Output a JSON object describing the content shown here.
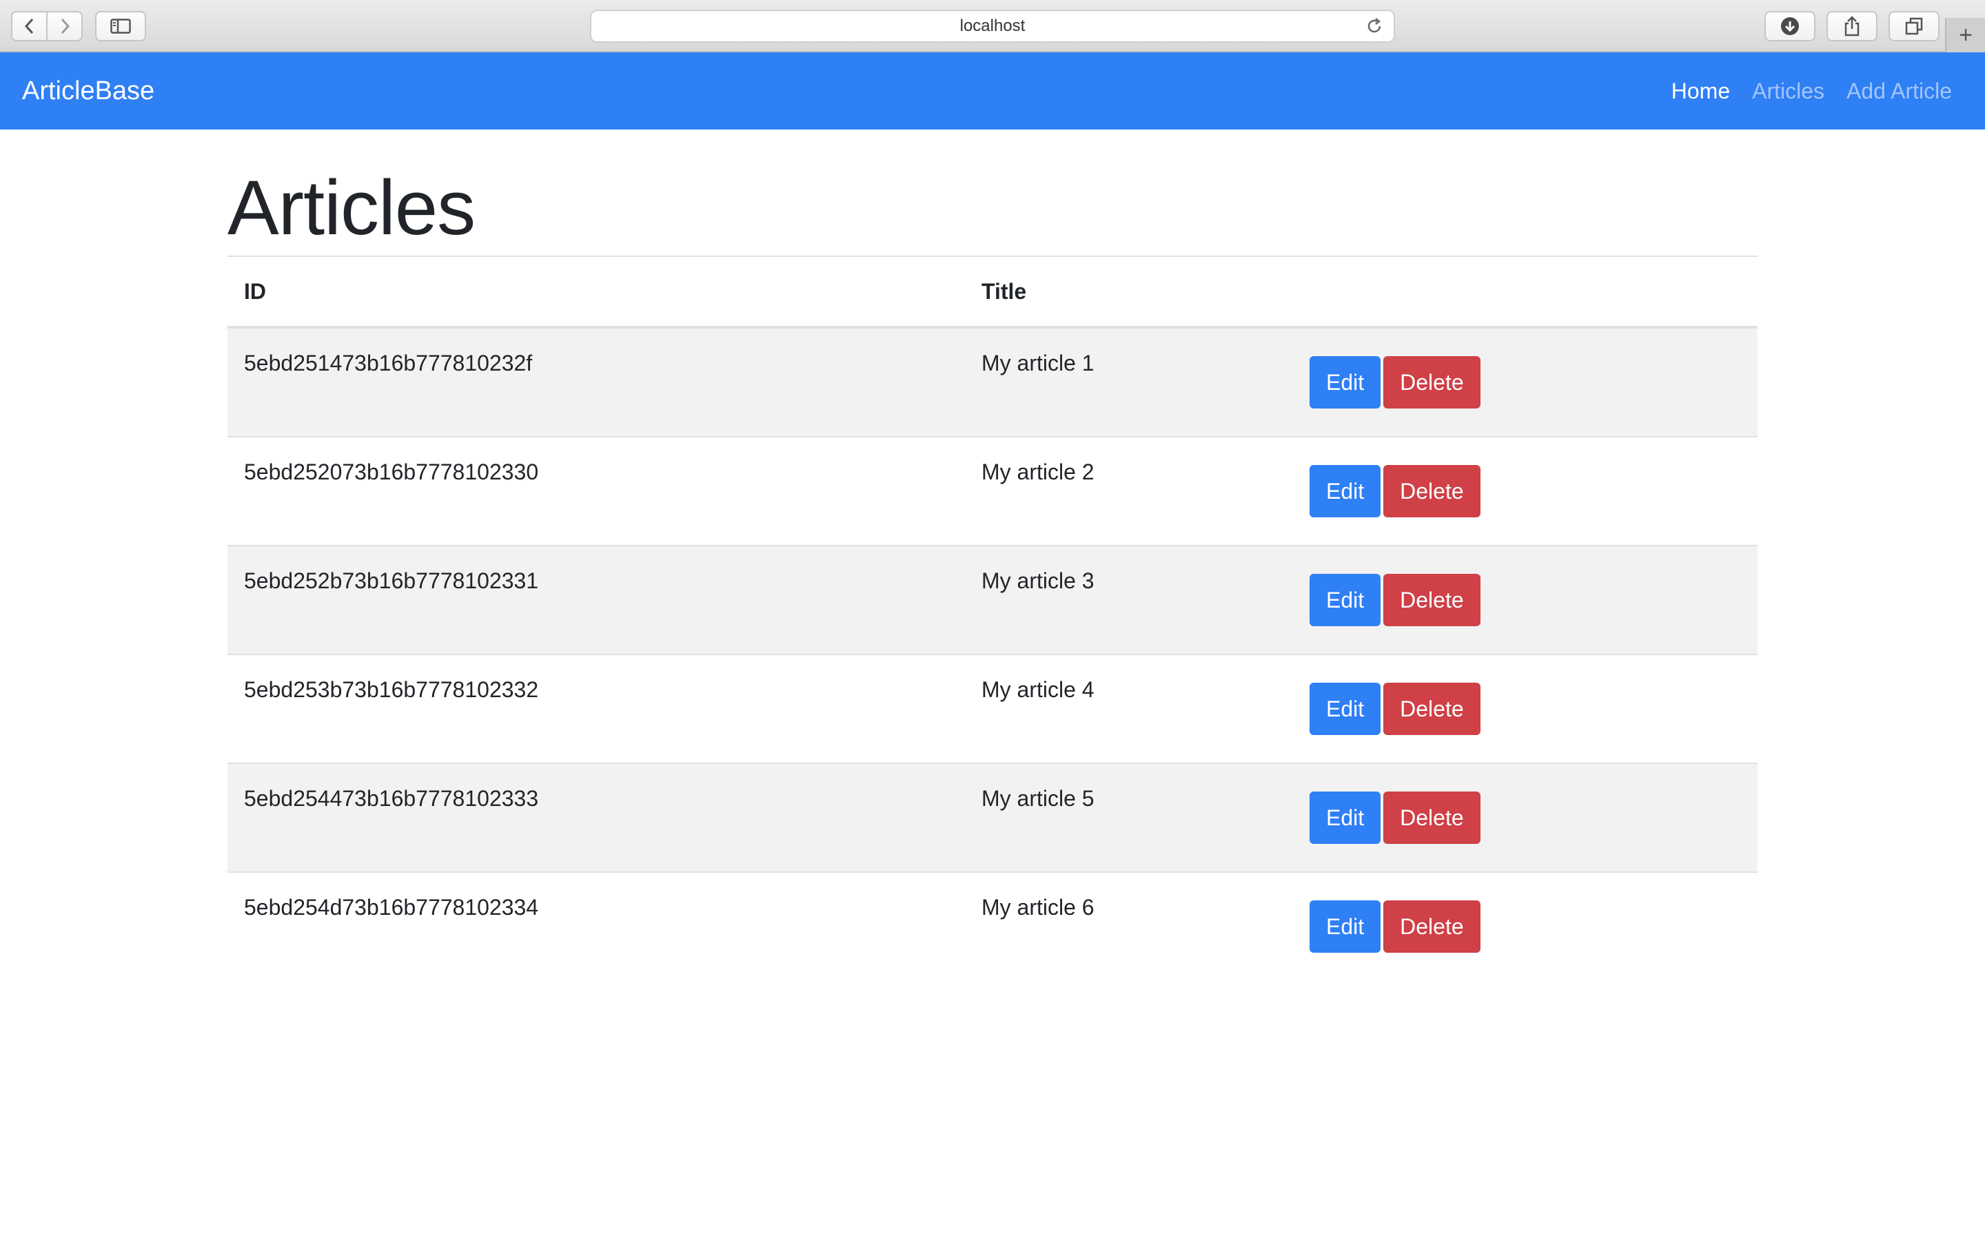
{
  "browser": {
    "url": "localhost",
    "new_tab_glyph": "+"
  },
  "navbar": {
    "brand": "ArticleBase",
    "links": [
      {
        "label": "Home",
        "active": true
      },
      {
        "label": "Articles",
        "active": false
      },
      {
        "label": "Add Article",
        "active": false
      }
    ]
  },
  "page": {
    "title": "Articles"
  },
  "table": {
    "headers": {
      "id": "ID",
      "title": "Title"
    },
    "rows": [
      {
        "id": "5ebd251473b16b777810232f",
        "title": "My article 1",
        "edit": "Edit",
        "delete": "Delete"
      },
      {
        "id": "5ebd252073b16b7778102330",
        "title": "My article 2",
        "edit": "Edit",
        "delete": "Delete"
      },
      {
        "id": "5ebd252b73b16b7778102331",
        "title": "My article 3",
        "edit": "Edit",
        "delete": "Delete"
      },
      {
        "id": "5ebd253b73b16b7778102332",
        "title": "My article 4",
        "edit": "Edit",
        "delete": "Delete"
      },
      {
        "id": "5ebd254473b16b7778102333",
        "title": "My article 5",
        "edit": "Edit",
        "delete": "Delete"
      },
      {
        "id": "5ebd254d73b16b7778102334",
        "title": "My article 6",
        "edit": "Edit",
        "delete": "Delete"
      }
    ]
  },
  "colors": {
    "primary": "#2f7ff5",
    "danger": "#cf4047",
    "striped_row": "#f2f2f2"
  },
  "icons": [
    "chevron-left-icon",
    "chevron-right-icon",
    "sidebar-icon",
    "reload-icon",
    "download-icon",
    "share-icon",
    "tabs-icon",
    "plus-icon"
  ]
}
